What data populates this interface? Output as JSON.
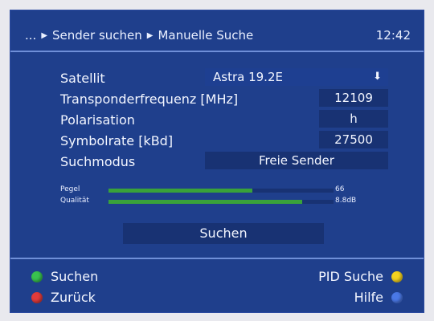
{
  "header": {
    "crumb_prefix": "...",
    "crumbs": [
      "Sender suchen",
      "Manuelle Suche"
    ],
    "time": "12:42"
  },
  "fields": {
    "satellite": {
      "label": "Satellit",
      "value": "Astra 19.2E"
    },
    "transponder": {
      "label": "Transponderfrequenz [MHz]",
      "value": "12109"
    },
    "polarisation": {
      "label": "Polarisation",
      "value": "h"
    },
    "symbolrate": {
      "label": "Symbolrate [kBd]",
      "value": "27500"
    },
    "suchmodus": {
      "label": "Suchmodus",
      "value": "Freie Sender"
    }
  },
  "meters": {
    "pegel": {
      "label": "Pegel",
      "value_text": "66",
      "fill_fraction": 0.64
    },
    "qualitaet": {
      "label": "Qualität",
      "value_text": "8.8dB",
      "fill_fraction": 0.86
    }
  },
  "actions": {
    "search": "Suchen"
  },
  "footer": {
    "left": [
      {
        "label": "Suchen",
        "color": "#39c14f"
      },
      {
        "label": "Zurück",
        "color": "#e23b3b"
      }
    ],
    "right": [
      {
        "label": "PID Suche",
        "color": "#f4d21f"
      },
      {
        "label": "Hilfe",
        "color": "#4a78e6"
      }
    ]
  },
  "icons": {
    "dropdown": "down-arrow-icon",
    "separator": "triangle-right-icon"
  }
}
